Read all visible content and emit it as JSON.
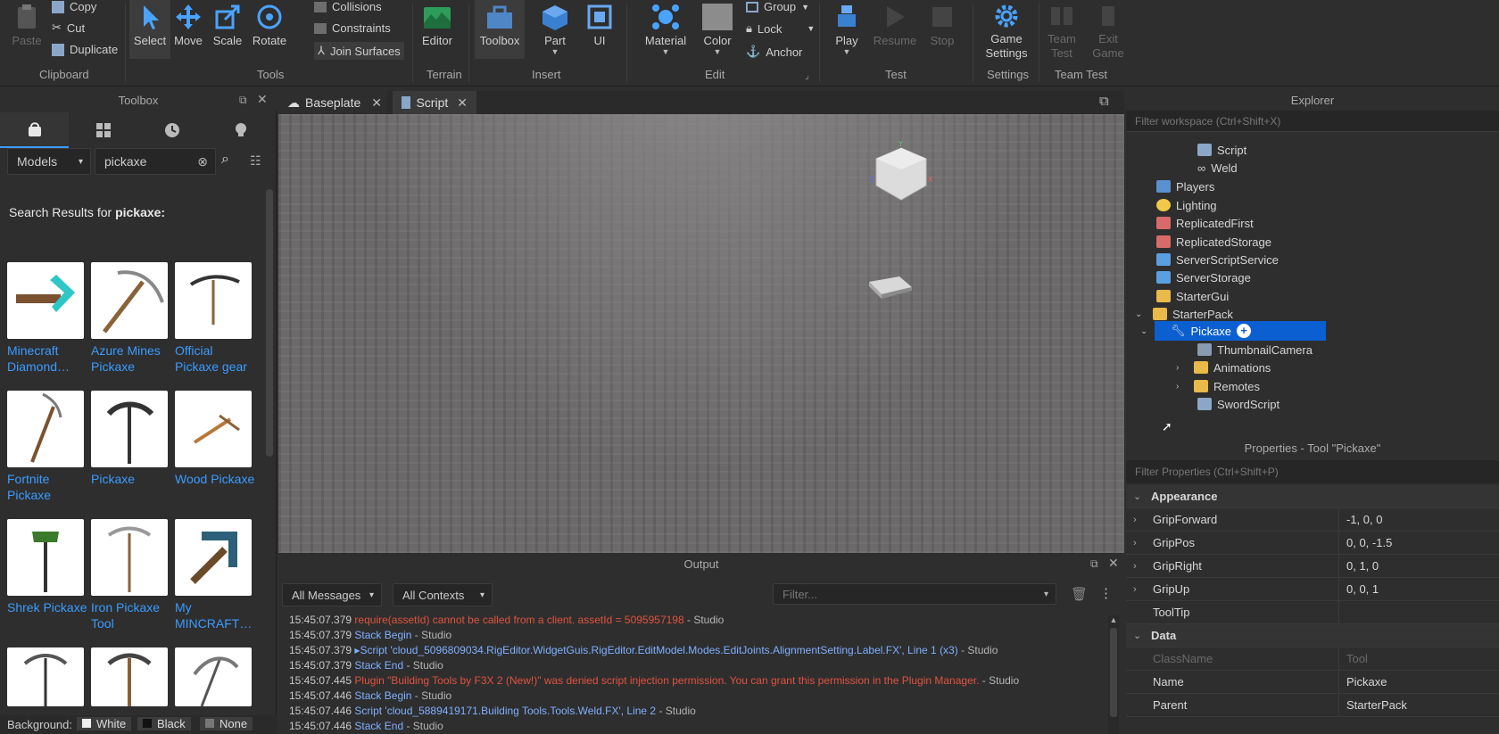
{
  "ribbon": {
    "clipboard": {
      "paste": "Paste",
      "copy": "Copy",
      "cut": "Cut",
      "duplicate": "Duplicate",
      "group": "Clipboard"
    },
    "tools": {
      "select": "Select",
      "move": "Move",
      "scale": "Scale",
      "rotate": "Rotate",
      "collisions": "Collisions",
      "constraints": "Constraints",
      "join_surfaces": "Join Surfaces",
      "group": "Tools"
    },
    "terrain": {
      "editor": "Editor",
      "group": "Terrain"
    },
    "insert": {
      "toolbox": "Toolbox",
      "part": "Part",
      "ui": "UI",
      "group": "Insert"
    },
    "edit": {
      "material": "Material",
      "color": "Color",
      "group_btn": "Group",
      "lock": "Lock",
      "anchor": "Anchor",
      "group": "Edit"
    },
    "test": {
      "play": "Play",
      "resume": "Resume",
      "stop": "Stop",
      "group": "Test"
    },
    "settings": {
      "game_settings": "Game Settings",
      "group": "Settings"
    },
    "team_test": {
      "team_test": "Team Test",
      "exit_game": "Exit Game",
      "group": "Team Test"
    }
  },
  "toolbox": {
    "title": "Toolbox",
    "category": "Models",
    "search_value": "pickaxe",
    "results_prefix": "Search Results for ",
    "results_query": "pickaxe:",
    "items": [
      {
        "label": "Minecraft Diamond…"
      },
      {
        "label": "Azure Mines Pickaxe"
      },
      {
        "label": "Official Pickaxe gear"
      },
      {
        "label": "Fortnite Pickaxe"
      },
      {
        "label": "Pickaxe"
      },
      {
        "label": "Wood Pickaxe"
      },
      {
        "label": "Shrek Pickaxe"
      },
      {
        "label": "Iron Pickaxe Tool"
      },
      {
        "label": "My MINCRAFT…"
      }
    ],
    "background_label": "Background:",
    "bg_options": [
      "White",
      "Black",
      "None"
    ]
  },
  "doc_tabs": [
    {
      "label": "Baseplate"
    },
    {
      "label": "Script"
    }
  ],
  "output": {
    "title": "Output",
    "filter_messages": "All Messages",
    "filter_contexts": "All Contexts",
    "filter_placeholder": "Filter...",
    "lines": [
      {
        "time": "15:45:07.379",
        "msg": "require(assetId) cannot be called from a client.  assetId = 5095957198",
        "src": " - Studio",
        "kind": "err"
      },
      {
        "time": "15:45:07.379",
        "msg": "Stack Begin",
        "src": " - Studio",
        "kind": "info"
      },
      {
        "time": "15:45:07.379",
        "msg": "▸Script 'cloud_5096809034.RigEditor.WidgetGuis.RigEditor.EditModel.Modes.EditJoints.AlignmentSetting.Label.FX', Line 1 (x3)",
        "src": " - Studio",
        "kind": "info"
      },
      {
        "time": "15:45:07.379",
        "msg": "Stack End",
        "src": " - Studio",
        "kind": "info"
      },
      {
        "time": "15:45:07.445",
        "msg": "Plugin \"Building Tools by F3X 2 (New!)\" was denied script injection permission. You can grant this permission in the Plugin Manager.",
        "src": " - Studio",
        "kind": "err"
      },
      {
        "time": "15:45:07.446",
        "msg": "Stack Begin",
        "src": " - Studio",
        "kind": "info"
      },
      {
        "time": "15:45:07.446",
        "msg": "Script 'cloud_5889419171.Building Tools.Tools.Weld.FX', Line 2",
        "src": " - Studio",
        "kind": "info"
      },
      {
        "time": "15:45:07.446",
        "msg": "Stack End",
        "src": " - Studio",
        "kind": "info"
      }
    ]
  },
  "explorer": {
    "title": "Explorer",
    "filter_placeholder": "Filter workspace (Ctrl+Shift+X)",
    "items": [
      {
        "label": "Script"
      },
      {
        "label": "Weld"
      },
      {
        "label": "Players"
      },
      {
        "label": "Lighting"
      },
      {
        "label": "ReplicatedFirst"
      },
      {
        "label": "ReplicatedStorage"
      },
      {
        "label": "ServerScriptService"
      },
      {
        "label": "ServerStorage"
      },
      {
        "label": "StarterGui"
      },
      {
        "label": "StarterPack"
      },
      {
        "label": "Pickaxe"
      },
      {
        "label": "ThumbnailCamera"
      },
      {
        "label": "Animations"
      },
      {
        "label": "Remotes"
      },
      {
        "label": "SwordScript"
      }
    ]
  },
  "properties": {
    "title": "Properties - Tool \"Pickaxe\"",
    "filter_placeholder": "Filter Properties (Ctrl+Shift+P)",
    "sections": {
      "appearance": "Appearance",
      "data": "Data"
    },
    "rows": [
      {
        "name": "GripForward",
        "value": "-1, 0, 0"
      },
      {
        "name": "GripPos",
        "value": "0, 0, -1.5"
      },
      {
        "name": "GripRight",
        "value": "0, 1, 0"
      },
      {
        "name": "GripUp",
        "value": "0, 0, 1"
      },
      {
        "name": "ToolTip",
        "value": ""
      }
    ],
    "data_rows": [
      {
        "name": "ClassName",
        "value": "Tool"
      },
      {
        "name": "Name",
        "value": "Pickaxe"
      },
      {
        "name": "Parent",
        "value": "StarterPack"
      }
    ]
  },
  "colors": {
    "accent": "#3b9bff",
    "selection": "#0b5fd1",
    "error": "#e0533f",
    "info": "#7fb0ff"
  }
}
